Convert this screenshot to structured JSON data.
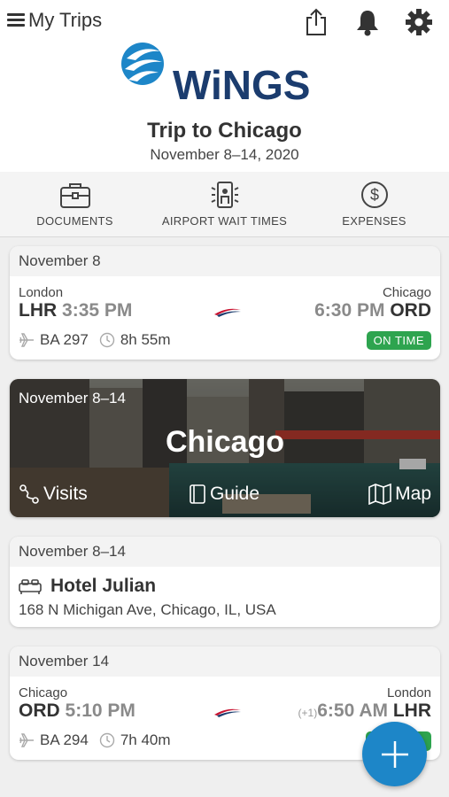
{
  "nav": {
    "menu_label": "My Trips",
    "icons": [
      "share-icon",
      "bell-icon",
      "gear-icon"
    ]
  },
  "brand": {
    "name": "WiNGS",
    "color": "#1b3c6e",
    "accent": "#1d86c8"
  },
  "trip": {
    "title": "Trip to Chicago",
    "dates": "November 8–14, 2020"
  },
  "actions": [
    {
      "label": "DOCUMENTS",
      "icon": "briefcase-icon"
    },
    {
      "label": "AIRPORT WAIT TIMES",
      "icon": "airport-icon"
    },
    {
      "label": "EXPENSES",
      "icon": "dollar-icon"
    }
  ],
  "flight1": {
    "date": "November 8",
    "from_city": "London",
    "from_code": "LHR",
    "depart_time": "3:35 PM",
    "to_city": "Chicago",
    "to_code": "ORD",
    "arrive_time": "6:30 PM",
    "flight_no": "BA 297",
    "duration": "8h 55m",
    "status": "ON TIME"
  },
  "city": {
    "dates": "November 8–14",
    "name": "Chicago",
    "visits_label": "Visits",
    "guide_label": "Guide",
    "map_label": "Map"
  },
  "hotel": {
    "dates": "November 8–14",
    "name": "Hotel Julian",
    "address": "168 N Michigan Ave, Chicago, IL, USA"
  },
  "flight2": {
    "date": "November 14",
    "from_city": "Chicago",
    "from_code": "ORD",
    "depart_time": "5:10 PM",
    "to_city": "London",
    "to_code": "LHR",
    "arrive_time": "6:50 AM",
    "day_offset": "(+1)",
    "flight_no": "BA 294",
    "duration": "7h 40m"
  },
  "colors": {
    "status_green": "#2ea44f",
    "fab_blue": "#1d86c8"
  }
}
